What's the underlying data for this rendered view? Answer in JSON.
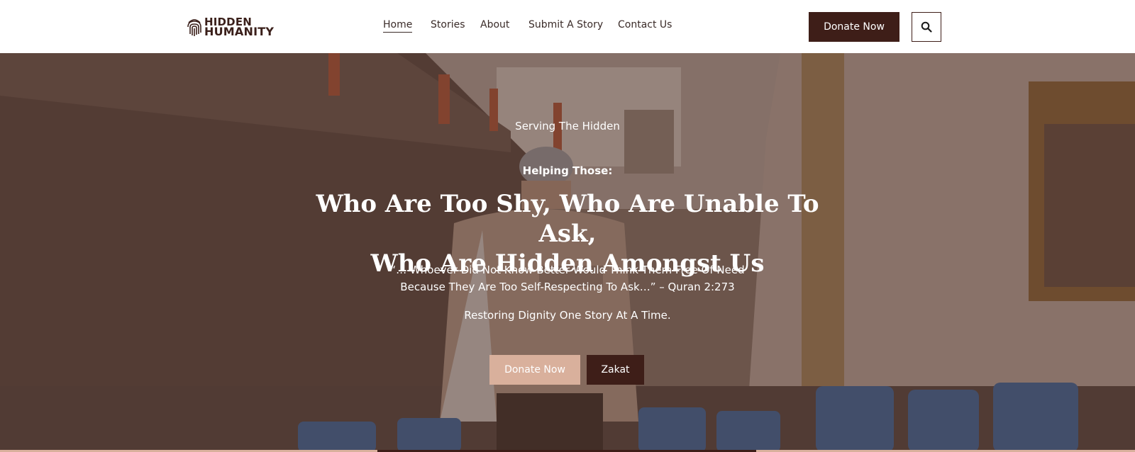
{
  "brand": {
    "logo_line1": "HIDDEN",
    "logo_line2": "HUMANITY",
    "logo_color": "#3a1f1a"
  },
  "nav": {
    "items": [
      {
        "label": "Home",
        "active": true
      },
      {
        "label": "Stories",
        "active": false
      },
      {
        "label": "About",
        "active": false
      },
      {
        "label": "Submit A Story",
        "active": false
      },
      {
        "label": "Contact Us",
        "active": false
      }
    ]
  },
  "header": {
    "donate_label": "Donate Now",
    "search_icon": "search-icon"
  },
  "hero": {
    "eyebrow": "Serving The Hidden",
    "subhead": "Helping Those:",
    "headline_line1": "Who Are Too Shy, Who Are Unable To Ask,",
    "headline_line2": "Who Are Hidden Amongst Us",
    "quote_line1": "“… Whoever Did Not Know Better Would Think Them Free Of Need",
    "quote_line2": "Because They Are Too Self-Respecting To Ask…” – Quran 2:273",
    "tagline": "Restoring Dignity One Story At A Time.",
    "donate_button": "Donate Now",
    "zakat_button": "Zakat"
  },
  "colors": {
    "primary_dark": "#3e1e18",
    "accent_light": "#d9b09c",
    "text_on_dark": "#ffffff"
  }
}
